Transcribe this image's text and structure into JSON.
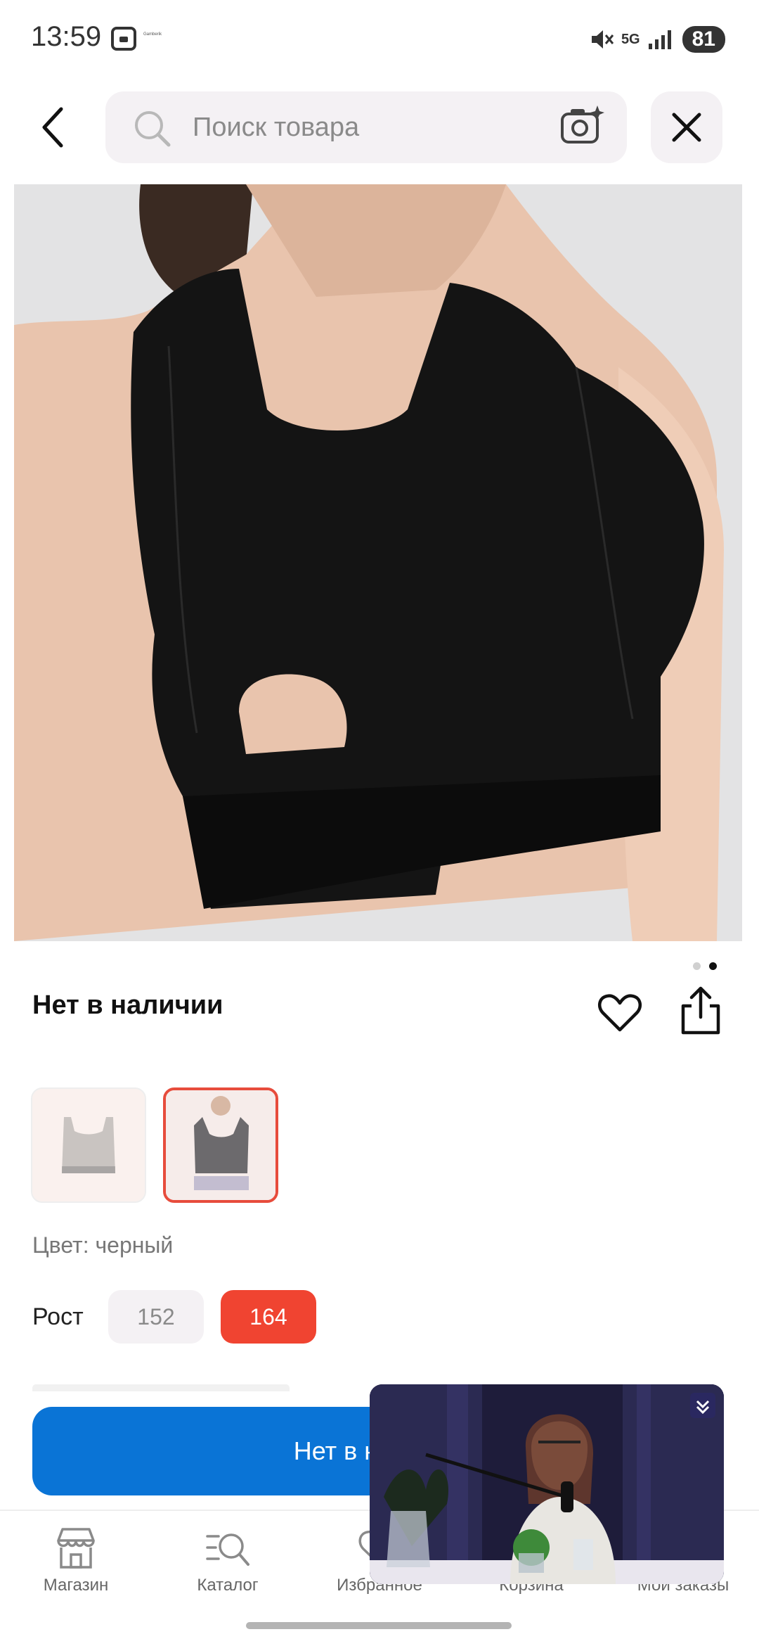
{
  "status_bar": {
    "time": "13:59",
    "network": "5G",
    "battery": "81",
    "app_label": "Gamberik"
  },
  "search": {
    "placeholder": "Поиск товара",
    "value": ""
  },
  "product": {
    "availability": "Нет в наличии",
    "color_label": "Цвет: черный",
    "images_count": 2,
    "active_image": 2,
    "thumbnails": [
      {
        "name": "white-top",
        "selected": false
      },
      {
        "name": "black-top",
        "selected": true
      }
    ],
    "size_label": "Рост",
    "sizes": [
      {
        "label": "152",
        "selected": false
      },
      {
        "label": "164",
        "selected": true
      }
    ]
  },
  "action_button": {
    "label": "Нет в наличии"
  },
  "bottom_nav": {
    "items": [
      {
        "label": "Магазин",
        "icon": "store-icon"
      },
      {
        "label": "Каталог",
        "icon": "catalog-search-icon"
      },
      {
        "label": "Избранное",
        "icon": "heart-icon"
      },
      {
        "label": "Корзина",
        "icon": "cart-icon"
      },
      {
        "label": "Мои заказы",
        "icon": "orders-icon"
      }
    ]
  },
  "colors": {
    "accent_red": "#f04431",
    "primary_blue": "#0a74d6",
    "chip_bg": "#f4f1f4"
  }
}
